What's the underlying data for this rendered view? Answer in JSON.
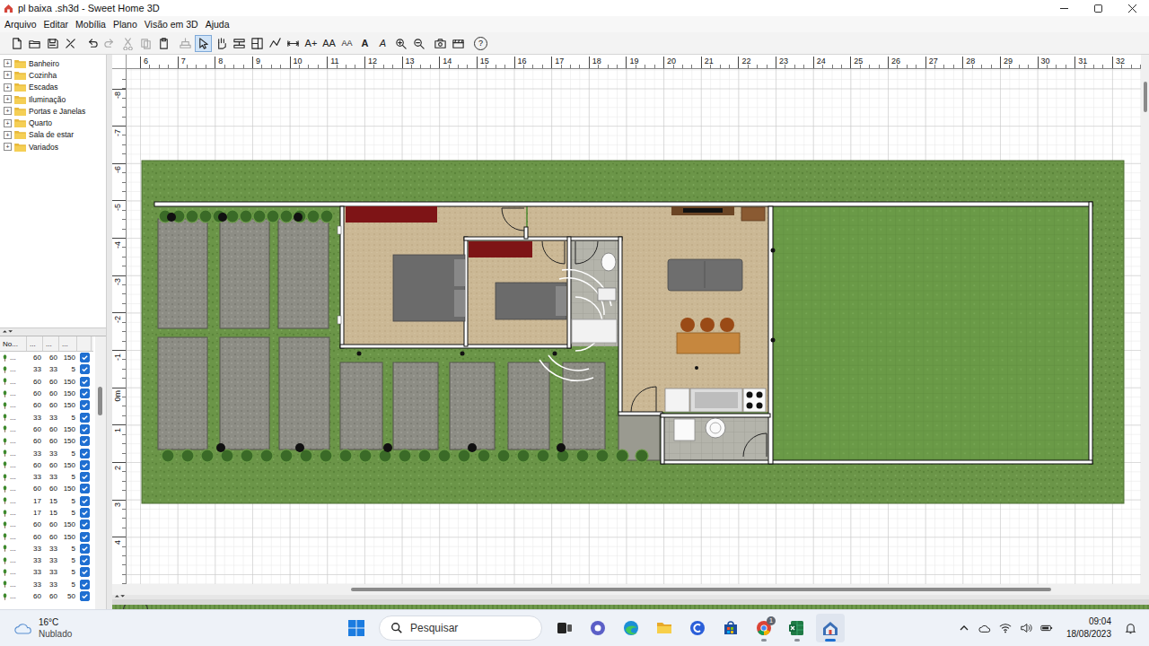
{
  "window": {
    "title": "pl baixa .sh3d - Sweet Home 3D"
  },
  "menu": [
    "Arquivo",
    "Editar",
    "Mobília",
    "Plano",
    "Visão em 3D",
    "Ajuda"
  ],
  "toolbar": {
    "actions": [
      {
        "disabled": false
      },
      {
        "disabled": false
      },
      {
        "disabled": false
      },
      {
        "disabled": false
      },
      {
        "disabled": false
      },
      {
        "disabled": true
      },
      {
        "disabled": true
      },
      {
        "disabled": true
      },
      {
        "disabled": false
      },
      {
        "disabled": true
      }
    ],
    "modes": [
      {
        "selected": true
      },
      {
        "selected": false
      },
      {
        "selected": false
      },
      {
        "selected": false
      },
      {
        "selected": false
      },
      {
        "selected": false
      }
    ],
    "text_buttons": [
      "A+",
      "AA",
      "AA",
      "A",
      "A"
    ],
    "help": "?"
  },
  "catalog": [
    {
      "label": "Banheiro",
      "expander": "+",
      "expanded": false
    },
    {
      "label": "Cozinha",
      "expander": "+",
      "expanded": false
    },
    {
      "label": "Escadas",
      "expander": "+",
      "expanded": false
    },
    {
      "label": "Iluminação",
      "expander": "+",
      "expanded": false
    },
    {
      "label": "Portas e Janelas",
      "expander": "+",
      "expanded": false
    },
    {
      "label": "Quarto",
      "expander": "+",
      "expanded": false
    },
    {
      "label": "Sala de estar",
      "expander": "+",
      "expanded": false
    },
    {
      "label": "Variados",
      "expander": "+",
      "expanded": false
    }
  ],
  "furniture_table": {
    "columns": [
      "No...",
      "...",
      "...",
      "..."
    ],
    "rows": [
      {
        "name": "...",
        "width": "60",
        "depth": "60",
        "height": "150",
        "visible": true
      },
      {
        "name": "...",
        "width": "33",
        "depth": "33",
        "height": "5",
        "visible": true
      },
      {
        "name": "...",
        "width": "60",
        "depth": "60",
        "height": "150",
        "visible": true
      },
      {
        "name": "...",
        "width": "60",
        "depth": "60",
        "height": "150",
        "visible": true
      },
      {
        "name": "...",
        "width": "60",
        "depth": "60",
        "height": "150",
        "visible": true
      },
      {
        "name": "...",
        "width": "33",
        "depth": "33",
        "height": "5",
        "visible": true
      },
      {
        "name": "...",
        "width": "60",
        "depth": "60",
        "height": "150",
        "visible": true
      },
      {
        "name": "...",
        "width": "60",
        "depth": "60",
        "height": "150",
        "visible": true
      },
      {
        "name": "...",
        "width": "33",
        "depth": "33",
        "height": "5",
        "visible": true
      },
      {
        "name": "...",
        "width": "60",
        "depth": "60",
        "height": "150",
        "visible": true
      },
      {
        "name": "...",
        "width": "33",
        "depth": "33",
        "height": "5",
        "visible": true
      },
      {
        "name": "...",
        "width": "60",
        "depth": "60",
        "height": "150",
        "visible": true
      },
      {
        "name": "...",
        "width": "17",
        "depth": "15",
        "height": "5",
        "visible": true
      },
      {
        "name": "...",
        "width": "17",
        "depth": "15",
        "height": "5",
        "visible": true
      },
      {
        "name": "...",
        "width": "60",
        "depth": "60",
        "height": "150",
        "visible": true
      },
      {
        "name": "...",
        "width": "60",
        "depth": "60",
        "height": "150",
        "visible": true
      },
      {
        "name": "...",
        "width": "33",
        "depth": "33",
        "height": "5",
        "visible": true
      },
      {
        "name": "...",
        "width": "33",
        "depth": "33",
        "height": "5",
        "visible": true
      },
      {
        "name": "...",
        "width": "33",
        "depth": "33",
        "height": "5",
        "visible": true
      },
      {
        "name": "...",
        "width": "33",
        "depth": "33",
        "height": "5",
        "visible": true
      },
      {
        "name": "...",
        "width": "60",
        "depth": "60",
        "height": "50",
        "visible": true
      }
    ]
  },
  "plan": {
    "ruler_x": [
      "6",
      "7",
      "8",
      "9",
      "10",
      "11",
      "12",
      "13",
      "14",
      "15",
      "16",
      "17",
      "18",
      "19",
      "20",
      "21",
      "22",
      "23",
      "24",
      "25",
      "26",
      "27",
      "28",
      "29",
      "30",
      "31",
      "32"
    ],
    "ruler_y": [
      "-8",
      "-7",
      "-6",
      "-5",
      "-4",
      "-3",
      "-2",
      "-1",
      "0m",
      "1",
      "2",
      "3",
      "4"
    ]
  },
  "taskbar": {
    "weather": {
      "temp": "16°C",
      "desc": "Nublado"
    },
    "search": {
      "placeholder": "Pesquisar"
    },
    "badge": "1",
    "clock": {
      "time": "09:04",
      "date": "18/08/2023"
    }
  }
}
